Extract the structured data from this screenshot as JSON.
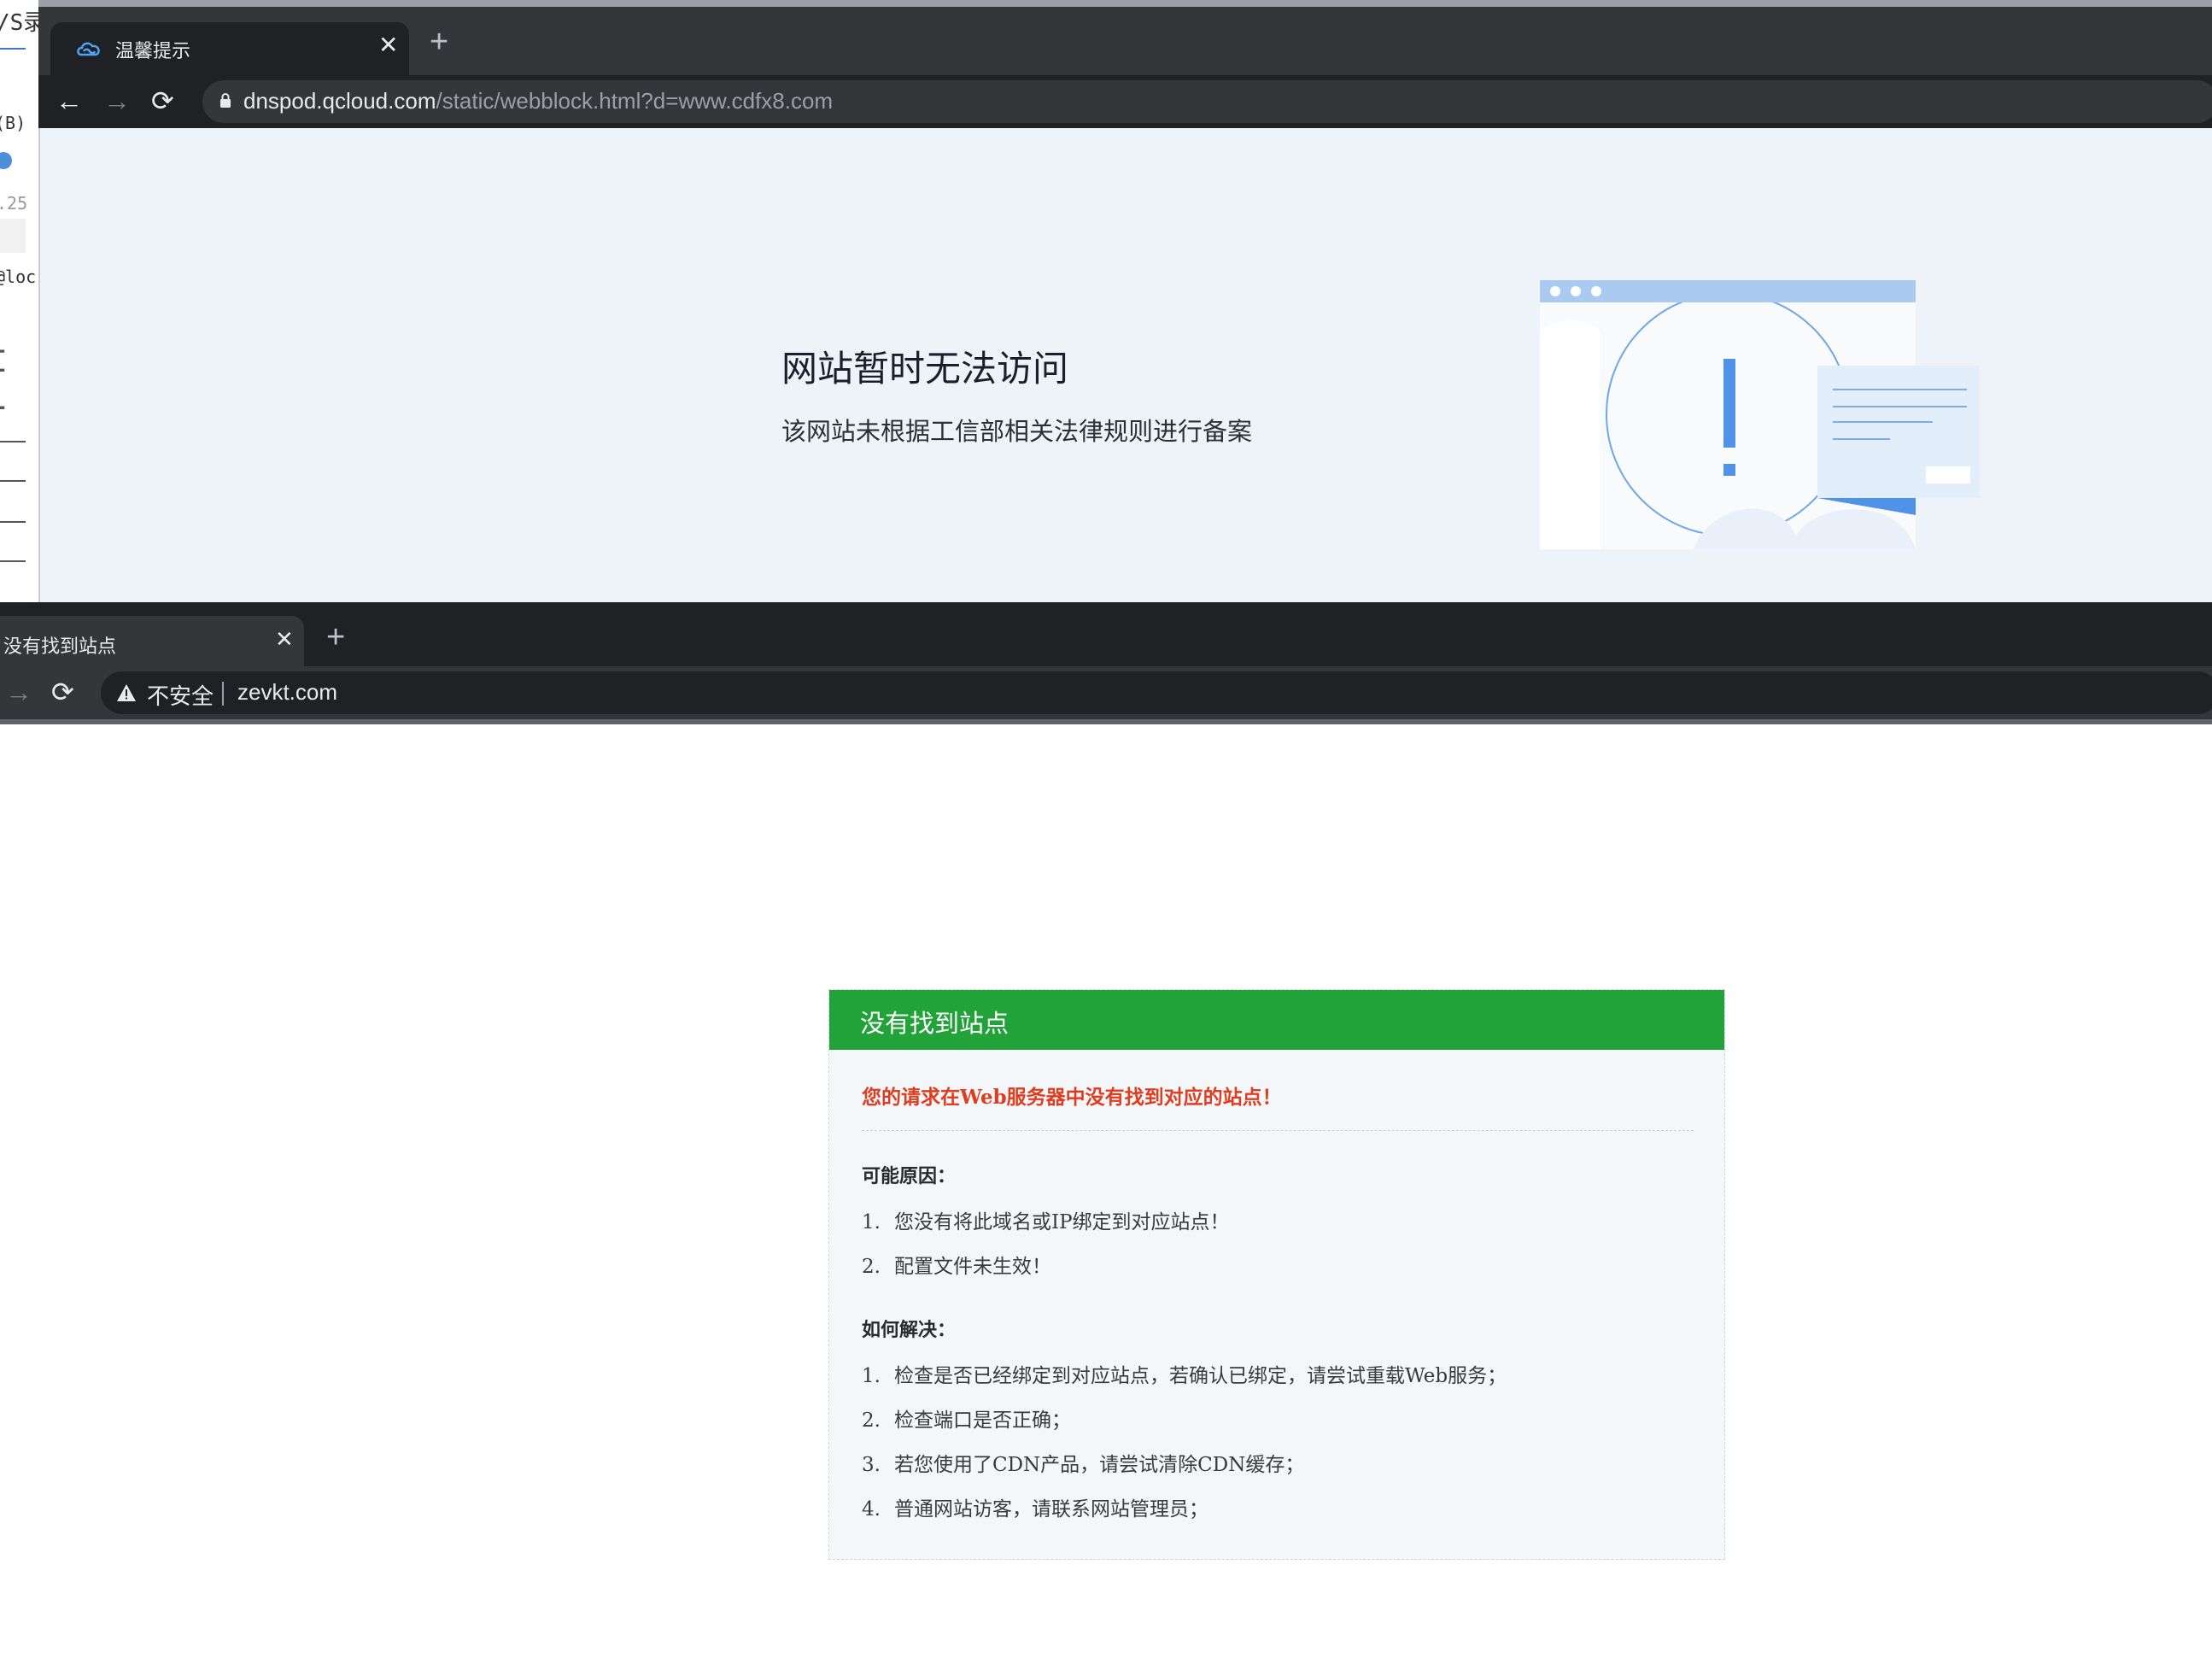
{
  "background_window": {
    "texts": [
      "/S录",
      "(B)",
      ".25",
      "@loc",
      "t",
      "l"
    ]
  },
  "window1": {
    "tab": {
      "title": "温馨提示",
      "close": "✕",
      "icon": "cloud-icon"
    },
    "new_tab": "+",
    "nav": {
      "back": "←",
      "forward": "→",
      "reload": "⟳"
    },
    "address": {
      "host": "dnspod.qcloud.com",
      "path": "/static/webblock.html?d=www.cdfx8.com"
    },
    "page": {
      "heading": "网站暂时无法访问",
      "subheading": "该网站未根据工信部相关法律规则进行备案"
    }
  },
  "window2": {
    "tab": {
      "title": "没有找到站点",
      "close": "✕"
    },
    "new_tab": "+",
    "nav": {
      "forward": "→",
      "reload": "⟳"
    },
    "address": {
      "security_label": "不安全",
      "url": "zevkt.com"
    },
    "card": {
      "title": "没有找到站点",
      "error": "您的请求在Web服务器中没有找到对应的站点！",
      "reasons_title": "可能原因：",
      "reasons": [
        {
          "num": "1.",
          "text": "您没有将此域名或IP绑定到对应站点！"
        },
        {
          "num": "2.",
          "text": "配置文件未生效！"
        }
      ],
      "solutions_title": "如何解决：",
      "solutions": [
        {
          "num": "1.",
          "text": "检查是否已经绑定到对应站点，若确认已绑定，请尝试重载Web服务；"
        },
        {
          "num": "2.",
          "text": "检查端口是否正确；"
        },
        {
          "num": "3.",
          "text": "若您使用了CDN产品，请尝试清除CDN缓存；"
        },
        {
          "num": "4.",
          "text": "普通网站访客，请联系网站管理员；"
        }
      ]
    }
  },
  "colors": {
    "card_header": "#21a33a",
    "error_text": "#e03c1f",
    "page1_bg": "#eef3fa",
    "chrome_dark": "#202124"
  }
}
